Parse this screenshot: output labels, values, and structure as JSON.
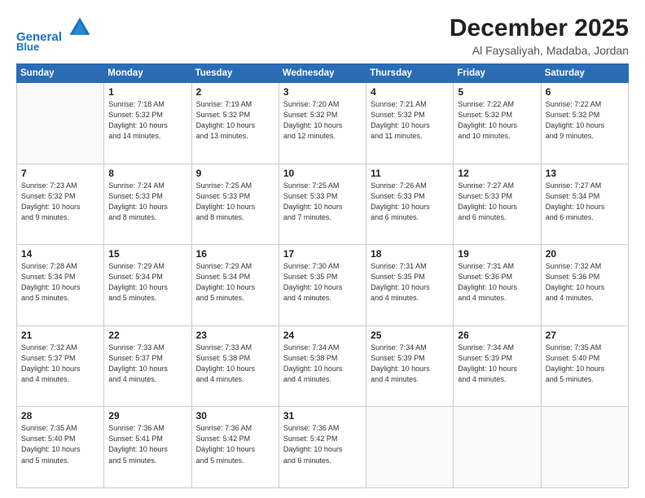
{
  "header": {
    "logo_line1": "General",
    "logo_line2": "Blue",
    "month": "December 2025",
    "location": "Al Faysaliyah, Madaba, Jordan"
  },
  "weekdays": [
    "Sunday",
    "Monday",
    "Tuesday",
    "Wednesday",
    "Thursday",
    "Friday",
    "Saturday"
  ],
  "weeks": [
    [
      {
        "day": "",
        "info": ""
      },
      {
        "day": "1",
        "info": "Sunrise: 7:18 AM\nSunset: 5:32 PM\nDaylight: 10 hours\nand 14 minutes."
      },
      {
        "day": "2",
        "info": "Sunrise: 7:19 AM\nSunset: 5:32 PM\nDaylight: 10 hours\nand 13 minutes."
      },
      {
        "day": "3",
        "info": "Sunrise: 7:20 AM\nSunset: 5:32 PM\nDaylight: 10 hours\nand 12 minutes."
      },
      {
        "day": "4",
        "info": "Sunrise: 7:21 AM\nSunset: 5:32 PM\nDaylight: 10 hours\nand 11 minutes."
      },
      {
        "day": "5",
        "info": "Sunrise: 7:22 AM\nSunset: 5:32 PM\nDaylight: 10 hours\nand 10 minutes."
      },
      {
        "day": "6",
        "info": "Sunrise: 7:22 AM\nSunset: 5:32 PM\nDaylight: 10 hours\nand 9 minutes."
      }
    ],
    [
      {
        "day": "7",
        "info": "Sunrise: 7:23 AM\nSunset: 5:32 PM\nDaylight: 10 hours\nand 9 minutes."
      },
      {
        "day": "8",
        "info": "Sunrise: 7:24 AM\nSunset: 5:33 PM\nDaylight: 10 hours\nand 8 minutes."
      },
      {
        "day": "9",
        "info": "Sunrise: 7:25 AM\nSunset: 5:33 PM\nDaylight: 10 hours\nand 8 minutes."
      },
      {
        "day": "10",
        "info": "Sunrise: 7:25 AM\nSunset: 5:33 PM\nDaylight: 10 hours\nand 7 minutes."
      },
      {
        "day": "11",
        "info": "Sunrise: 7:26 AM\nSunset: 5:33 PM\nDaylight: 10 hours\nand 6 minutes."
      },
      {
        "day": "12",
        "info": "Sunrise: 7:27 AM\nSunset: 5:33 PM\nDaylight: 10 hours\nand 6 minutes."
      },
      {
        "day": "13",
        "info": "Sunrise: 7:27 AM\nSunset: 5:34 PM\nDaylight: 10 hours\nand 6 minutes."
      }
    ],
    [
      {
        "day": "14",
        "info": "Sunrise: 7:28 AM\nSunset: 5:34 PM\nDaylight: 10 hours\nand 5 minutes."
      },
      {
        "day": "15",
        "info": "Sunrise: 7:29 AM\nSunset: 5:34 PM\nDaylight: 10 hours\nand 5 minutes."
      },
      {
        "day": "16",
        "info": "Sunrise: 7:29 AM\nSunset: 5:34 PM\nDaylight: 10 hours\nand 5 minutes."
      },
      {
        "day": "17",
        "info": "Sunrise: 7:30 AM\nSunset: 5:35 PM\nDaylight: 10 hours\nand 4 minutes."
      },
      {
        "day": "18",
        "info": "Sunrise: 7:31 AM\nSunset: 5:35 PM\nDaylight: 10 hours\nand 4 minutes."
      },
      {
        "day": "19",
        "info": "Sunrise: 7:31 AM\nSunset: 5:36 PM\nDaylight: 10 hours\nand 4 minutes."
      },
      {
        "day": "20",
        "info": "Sunrise: 7:32 AM\nSunset: 5:36 PM\nDaylight: 10 hours\nand 4 minutes."
      }
    ],
    [
      {
        "day": "21",
        "info": "Sunrise: 7:32 AM\nSunset: 5:37 PM\nDaylight: 10 hours\nand 4 minutes."
      },
      {
        "day": "22",
        "info": "Sunrise: 7:33 AM\nSunset: 5:37 PM\nDaylight: 10 hours\nand 4 minutes."
      },
      {
        "day": "23",
        "info": "Sunrise: 7:33 AM\nSunset: 5:38 PM\nDaylight: 10 hours\nand 4 minutes."
      },
      {
        "day": "24",
        "info": "Sunrise: 7:34 AM\nSunset: 5:38 PM\nDaylight: 10 hours\nand 4 minutes."
      },
      {
        "day": "25",
        "info": "Sunrise: 7:34 AM\nSunset: 5:39 PM\nDaylight: 10 hours\nand 4 minutes."
      },
      {
        "day": "26",
        "info": "Sunrise: 7:34 AM\nSunset: 5:39 PM\nDaylight: 10 hours\nand 4 minutes."
      },
      {
        "day": "27",
        "info": "Sunrise: 7:35 AM\nSunset: 5:40 PM\nDaylight: 10 hours\nand 5 minutes."
      }
    ],
    [
      {
        "day": "28",
        "info": "Sunrise: 7:35 AM\nSunset: 5:40 PM\nDaylight: 10 hours\nand 5 minutes."
      },
      {
        "day": "29",
        "info": "Sunrise: 7:36 AM\nSunset: 5:41 PM\nDaylight: 10 hours\nand 5 minutes."
      },
      {
        "day": "30",
        "info": "Sunrise: 7:36 AM\nSunset: 5:42 PM\nDaylight: 10 hours\nand 5 minutes."
      },
      {
        "day": "31",
        "info": "Sunrise: 7:36 AM\nSunset: 5:42 PM\nDaylight: 10 hours\nand 6 minutes."
      },
      {
        "day": "",
        "info": ""
      },
      {
        "day": "",
        "info": ""
      },
      {
        "day": "",
        "info": ""
      }
    ]
  ]
}
